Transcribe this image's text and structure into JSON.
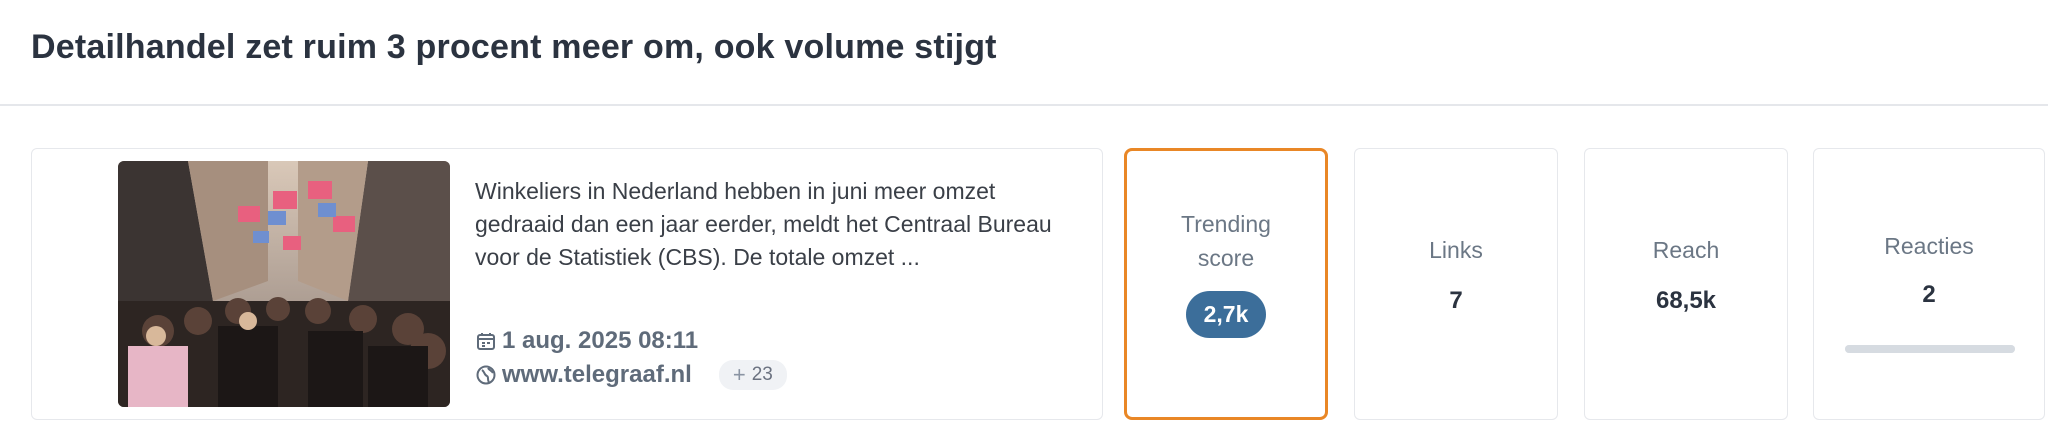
{
  "header": {
    "title": "Detailhandel zet ruim 3 procent meer om, ook volume stijgt"
  },
  "article": {
    "summary": "Winkeliers in Nederland hebben in juni meer omzet gedraaid dan een jaar eerder, meldt het Centraal Bureau voor de Statistiek (CBS). De totale omzet ...",
    "date": "1 aug. 2025 08:11",
    "source": "www.telegraaf.nl",
    "extra_sources": "23",
    "date_icon": "calendar-icon",
    "source_icon": "globe-icon",
    "plus_icon": "plus-icon"
  },
  "metrics": {
    "trending": {
      "label_line1": "Trending",
      "label_line2": "score",
      "value": "2,7k"
    },
    "links": {
      "label": "Links",
      "value": "7"
    },
    "reach": {
      "label": "Reach",
      "value": "68,5k"
    },
    "reacties": {
      "label": "Reacties",
      "value": "2",
      "bar_fill": 1.0
    }
  },
  "colors": {
    "accent_orange": "#e98726",
    "score_blue": "#3c6e9a"
  }
}
